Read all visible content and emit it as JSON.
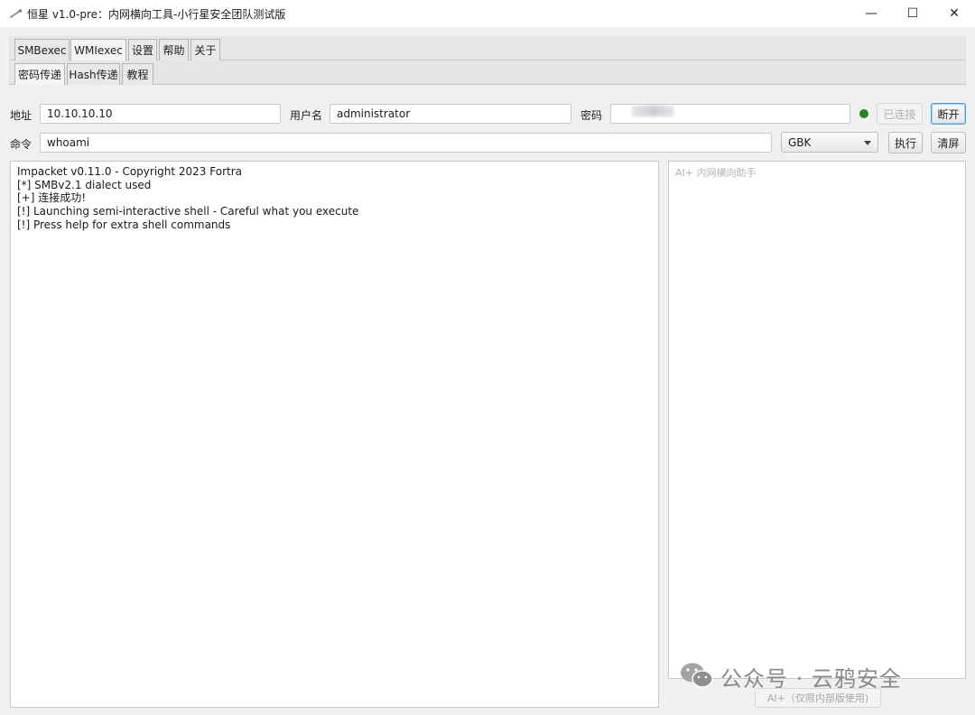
{
  "window": {
    "title": "恒星 v1.0-pre：内网横向工具-小行星安全团队测试版",
    "controls": {
      "minimize": "—",
      "maximize": "☐",
      "close": "✕"
    }
  },
  "main_tabs": [
    {
      "label": "SMBexec"
    },
    {
      "label": "WMIexec"
    },
    {
      "label": "设置"
    },
    {
      "label": "帮助"
    },
    {
      "label": "关于"
    }
  ],
  "sub_tabs": [
    {
      "label": "密码传递"
    },
    {
      "label": "Hash传递"
    },
    {
      "label": "教程"
    }
  ],
  "form": {
    "address_label": "地址",
    "address_value": "10.10.10.10",
    "username_label": "用户名",
    "username_value": "administrator",
    "password_label": "密码",
    "connected_button": "已连接",
    "disconnect_button": "断开",
    "command_label": "命令",
    "command_value": "whoami",
    "encoding_selected": "GBK",
    "execute_button": "执行",
    "clear_button": "清屏"
  },
  "output": {
    "lines": [
      "Impacket v0.11.0 - Copyright 2023 Fortra",
      "[*] SMBv2.1 dialect used",
      "[+] 连接成功!",
      "[!] Launching semi-interactive shell - Careful what you execute",
      "[!] Press help for extra shell commands"
    ]
  },
  "ai_panel": {
    "placeholder": "AI+ 内网横向助手",
    "button": "AI+（仅限内部版使用)"
  },
  "watermark": {
    "text": "公众号 · 云鸦安全"
  },
  "colors": {
    "status_connected": "#1c8a1c",
    "focus_border": "#4f9fdc"
  },
  "icons": {
    "app": "comet-icon",
    "watermark": "wechat-icon",
    "status": "status-dot-icon"
  }
}
